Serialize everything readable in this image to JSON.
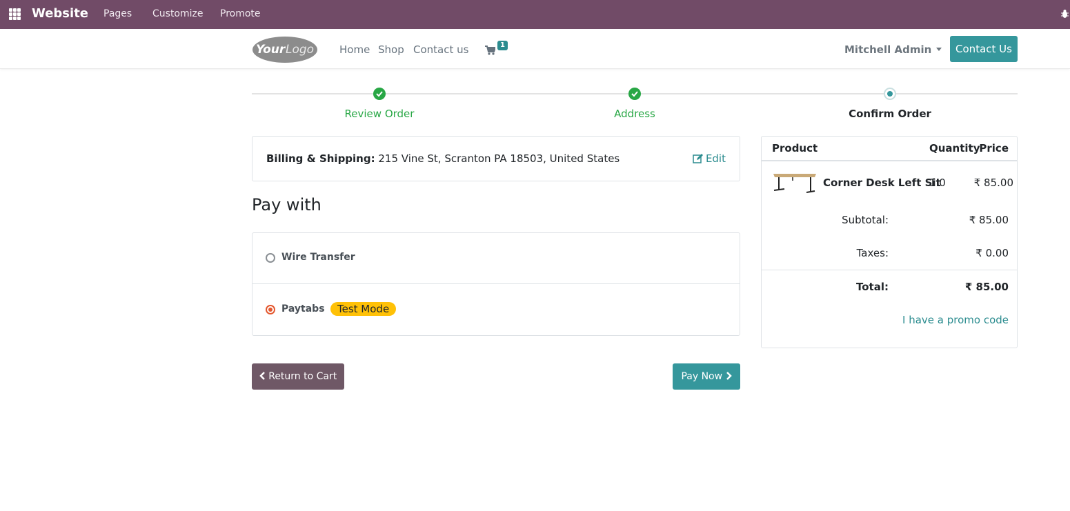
{
  "topbar": {
    "brand": "Website",
    "menu": [
      "Pages",
      "Customize",
      "Promote"
    ],
    "bg_color": "#714b67"
  },
  "header": {
    "logo_text": "YourLogo",
    "nav": [
      "Home",
      "Shop",
      "Contact us"
    ],
    "cart_count": "1",
    "user_name": "Mitchell Admin",
    "contact_button": "Contact Us",
    "accent_color": "#35979c"
  },
  "wizard": {
    "steps": [
      {
        "label": "Review Order",
        "state": "done"
      },
      {
        "label": "Address",
        "state": "done"
      },
      {
        "label": "Confirm Order",
        "state": "current"
      }
    ]
  },
  "billing": {
    "label": "Billing & Shipping:",
    "address": "215 Vine St, Scranton PA 18503, United States",
    "edit_label": "Edit"
  },
  "payment": {
    "heading": "Pay with",
    "options": [
      {
        "name": "Wire Transfer",
        "selected": false
      },
      {
        "name": "Paytabs",
        "selected": true,
        "badge": "Test Mode"
      }
    ]
  },
  "actions": {
    "return_label": "Return to Cart",
    "pay_label": "Pay Now"
  },
  "summary": {
    "headers": {
      "product": "Product",
      "quantity": "Quantity",
      "price": "Price"
    },
    "items": [
      {
        "name": "Corner Desk Left Sit",
        "quantity": "1.0",
        "price": "₹ 85.00"
      }
    ],
    "subtotal_label": "Subtotal:",
    "subtotal": "₹ 85.00",
    "taxes_label": "Taxes:",
    "taxes": "₹ 0.00",
    "total_label": "Total:",
    "total": "₹ 85.00",
    "promo_label": "I have a promo code"
  }
}
